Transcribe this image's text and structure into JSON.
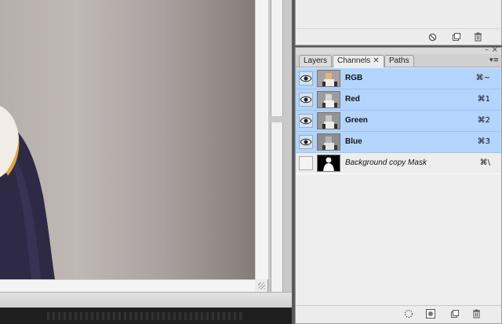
{
  "panels": {
    "top_panel": {
      "footer_icons": [
        "no-icon",
        "new-item-icon",
        "trash-icon"
      ]
    },
    "channels_panel": {
      "tabs": [
        {
          "label": "Layers",
          "active": false
        },
        {
          "label": "Channels",
          "active": true,
          "close": "✕"
        },
        {
          "label": "Paths",
          "active": false
        }
      ],
      "channels": [
        {
          "name": "RGB",
          "shortcut": "⌘~",
          "visible": true,
          "selected": true,
          "thumbnail": "rgb-thumb"
        },
        {
          "name": "Red",
          "shortcut": "⌘1",
          "visible": true,
          "selected": true,
          "thumbnail": "red-thumb"
        },
        {
          "name": "Green",
          "shortcut": "⌘2",
          "visible": true,
          "selected": true,
          "thumbnail": "green-thumb"
        },
        {
          "name": "Blue",
          "shortcut": "⌘3",
          "visible": true,
          "selected": true,
          "thumbnail": "blue-thumb"
        },
        {
          "name": "Background copy Mask",
          "shortcut": "⌘\\",
          "visible": false,
          "selected": false,
          "thumbnail": "mask-thumb"
        }
      ],
      "footer_icons": [
        "load-selection-icon",
        "save-selection-icon",
        "new-channel-icon",
        "trash-icon"
      ]
    }
  },
  "colors": {
    "selection": "#b3d4fc",
    "panel_bg": "#ededed"
  }
}
